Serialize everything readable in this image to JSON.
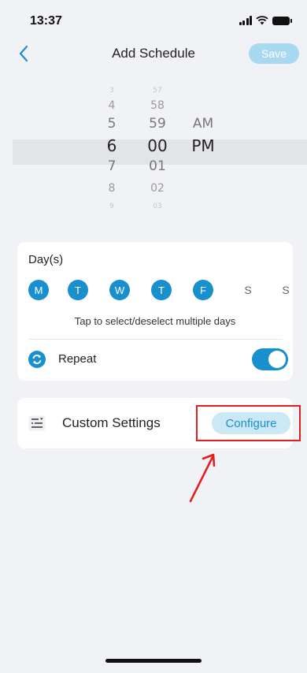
{
  "status_bar": {
    "time": "13:37"
  },
  "header": {
    "title": "Add Schedule",
    "save_label": "Save"
  },
  "time_picker": {
    "hours": [
      "3",
      "4",
      "5",
      "6",
      "7",
      "8",
      "9"
    ],
    "minutes": [
      "57",
      "58",
      "59",
      "00",
      "01",
      "02",
      "03"
    ],
    "periods": [
      "AM",
      "PM"
    ],
    "selected": {
      "hour": "6",
      "minute": "00",
      "period": "PM"
    }
  },
  "days": {
    "title": "Day(s)",
    "items": [
      {
        "label": "M",
        "selected": true
      },
      {
        "label": "T",
        "selected": true
      },
      {
        "label": "W",
        "selected": true
      },
      {
        "label": "T",
        "selected": true
      },
      {
        "label": "F",
        "selected": true
      },
      {
        "label": "S",
        "selected": false
      },
      {
        "label": "S",
        "selected": false
      }
    ],
    "hint": "Tap to select/deselect multiple days"
  },
  "repeat": {
    "label": "Repeat",
    "enabled": true
  },
  "custom_settings": {
    "label": "Custom Settings",
    "configure_label": "Configure"
  },
  "colors": {
    "accent": "#1a8fcd",
    "save_disabled": "#a9d9f0",
    "annotation": "#e0201c"
  }
}
